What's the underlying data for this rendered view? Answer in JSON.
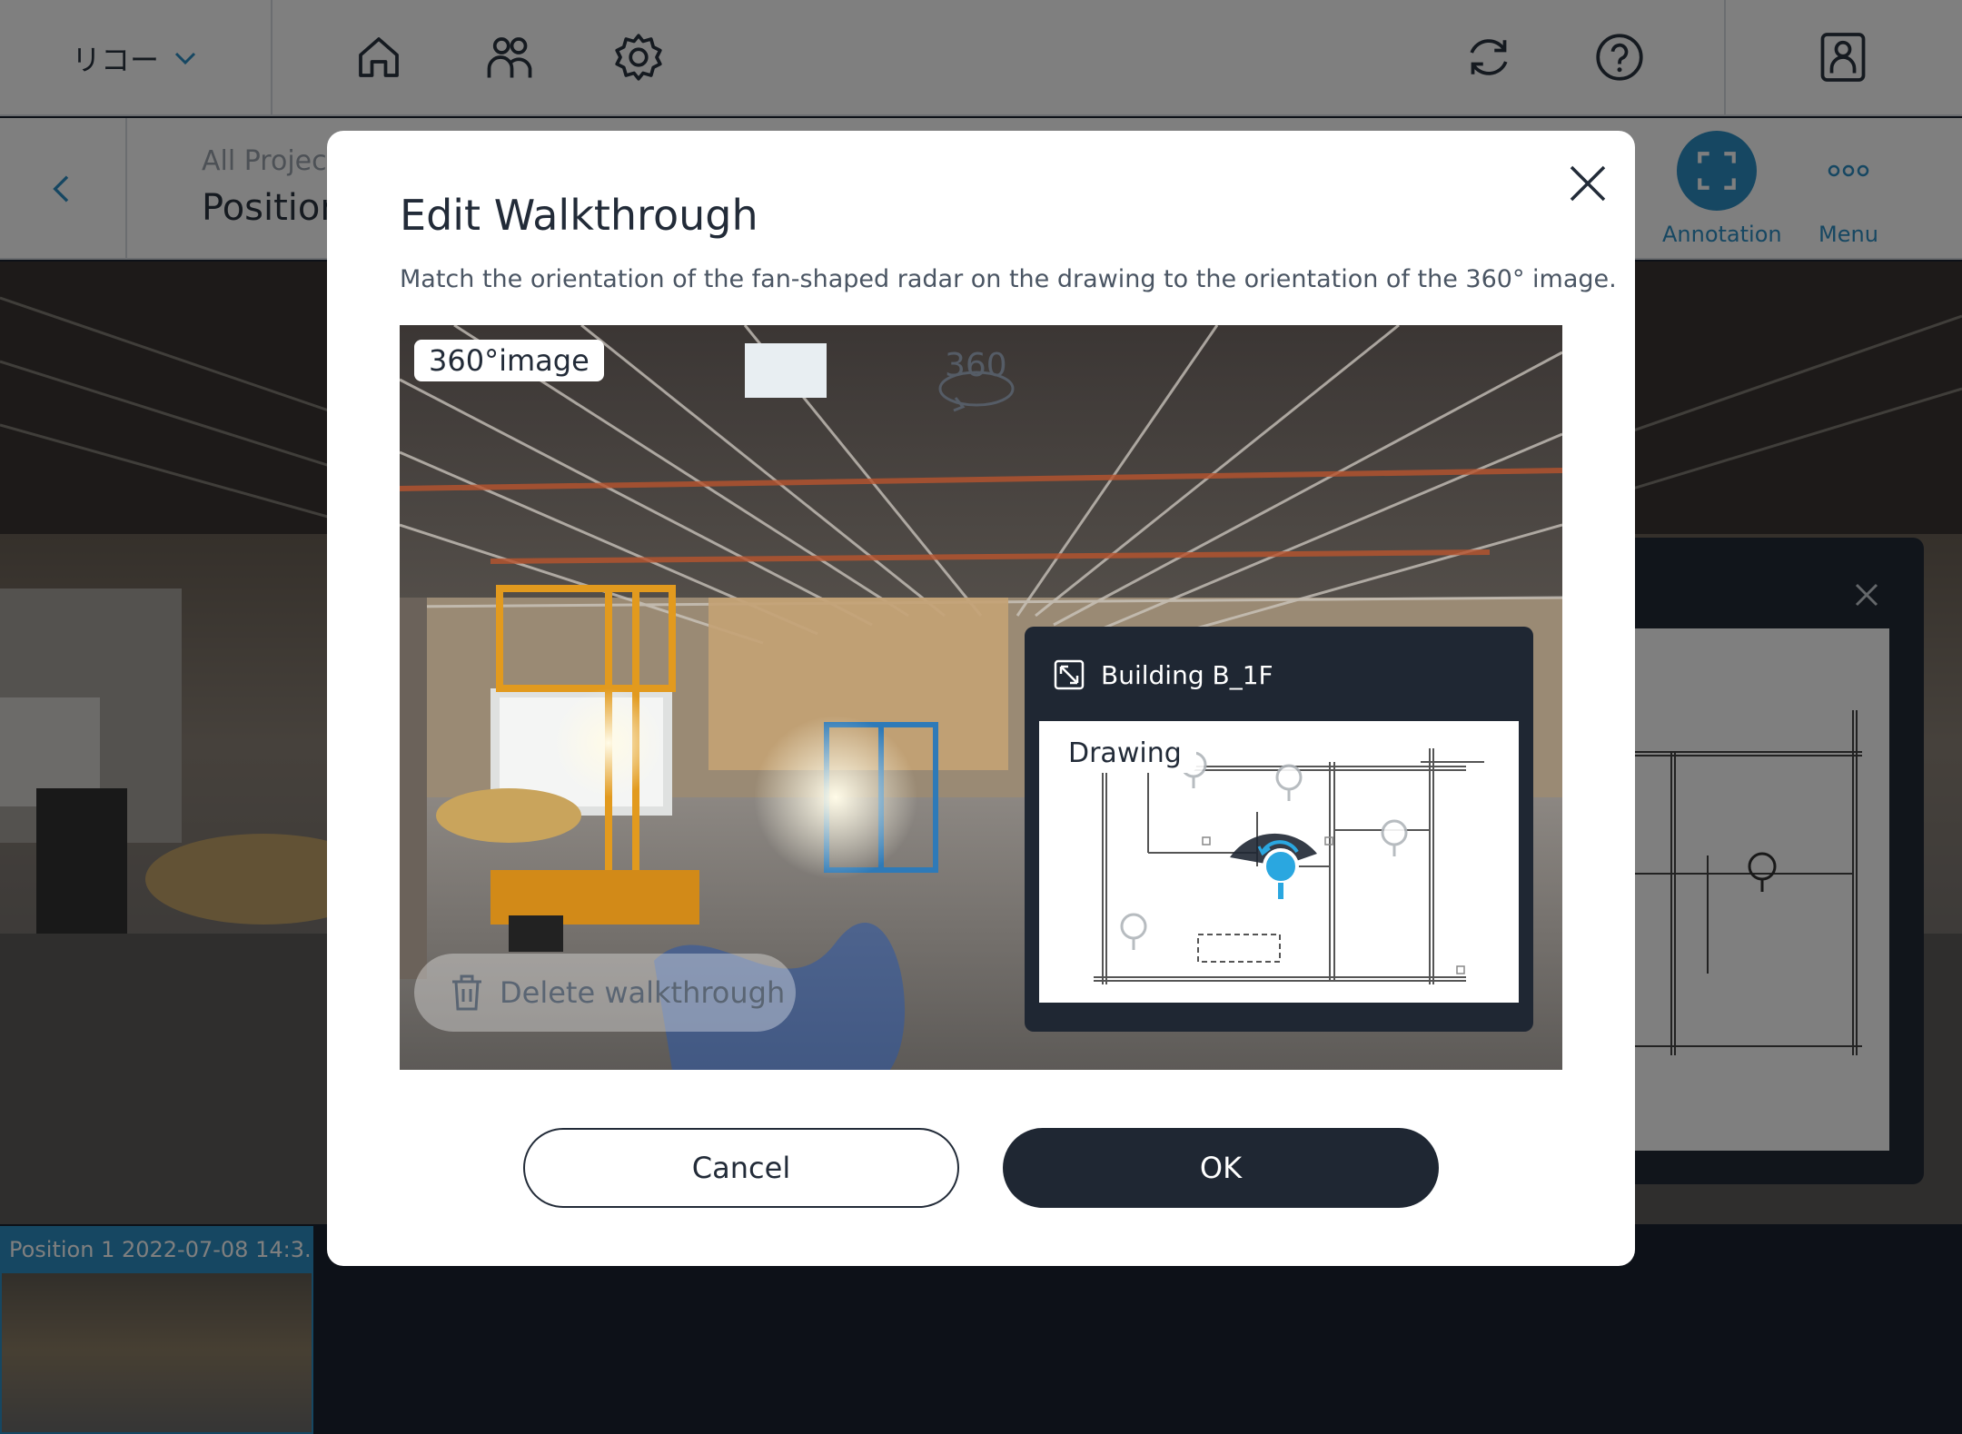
{
  "topbar": {
    "company": "リコー",
    "icons": [
      "home-icon",
      "members-icon",
      "settings-icon",
      "sync-icon",
      "help-icon",
      "profile-icon"
    ]
  },
  "subbar": {
    "breadcrumb": "All Projec",
    "title": "Position",
    "annotation_label": "Annotation",
    "menu_label": "Menu"
  },
  "thumbnail": {
    "label": "Position 1 2022-07-08 14:3..."
  },
  "modal": {
    "title": "Edit Walkthrough",
    "description": "Match the orientation of the fan-shaped radar on the drawing to the orientation of the 360° image.",
    "image_tag": "360°image",
    "badge_360": "360",
    "delete_label": "Delete walkthrough",
    "minimap_title": "Building B_1F",
    "drawing_tag": "Drawing",
    "cancel_label": "Cancel",
    "ok_label": "OK"
  },
  "colors": {
    "accent": "#2d8fc4",
    "dark": "#1f2733",
    "pin": "#2aa7e0"
  }
}
